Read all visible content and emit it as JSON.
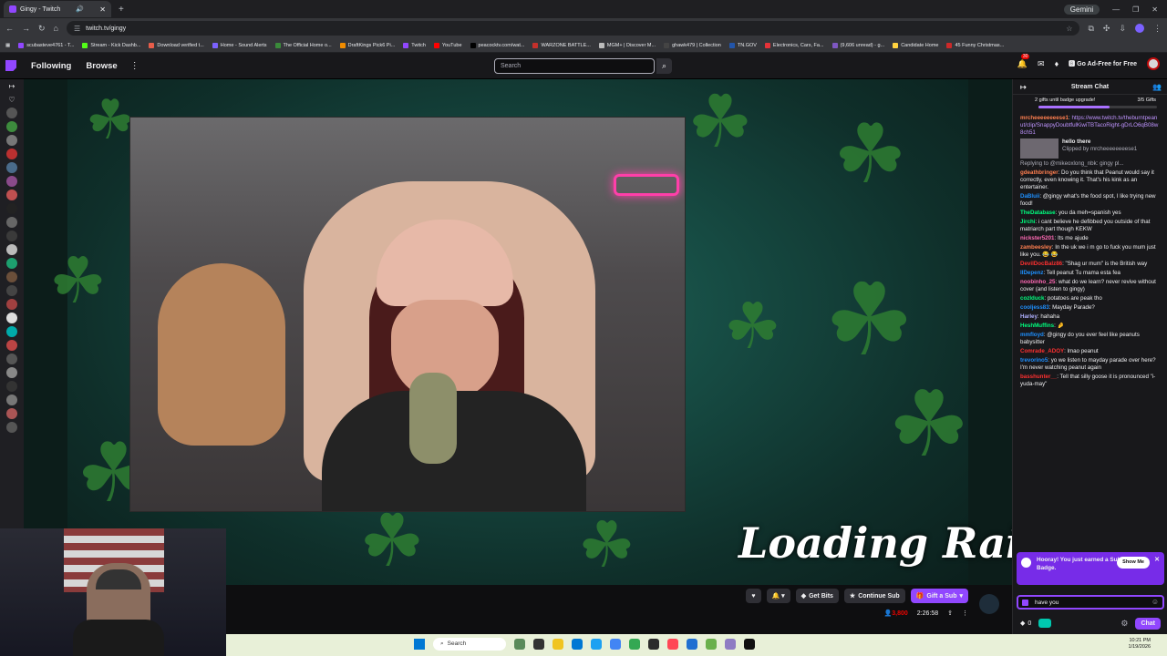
{
  "browser": {
    "tab_title": "Gingy - Twitch",
    "new_tab": "+",
    "profile_chip": "Gemini",
    "url": "twitch.tv/gingy",
    "bookmarks": [
      "scubasteve4761 - T...",
      "Stream - Kick Dashb...",
      "Download verified t...",
      "Home - Sound Alerts",
      "The Official Home o...",
      "DraftKings Pick6 Pi...",
      "Twitch",
      "YouTube",
      "peacocktv.com/wat...",
      "WARZONE BATTLE...",
      "MGM+ | Discover M...",
      "ghawk479 | Collection",
      "TN.GOV",
      "Electronics, Cars, Fa...",
      "(9,606 unread) - g...",
      "Candidate Home",
      "45 Funny Christmas..."
    ]
  },
  "twitch": {
    "nav_following": "Following",
    "nav_browse": "Browse",
    "search_placeholder": "Search",
    "notif_count": "30",
    "ad_free": "Go Ad-Free for Free"
  },
  "stream": {
    "overlay_text": "Loading Raid..",
    "buttons": {
      "get_bits": "Get Bits",
      "continue_sub": "Continue Sub",
      "gift_sub": "Gift a Sub"
    },
    "viewers": "3,800",
    "uptime": "2:26:58"
  },
  "chat": {
    "title": "Stream Chat",
    "gift_progress_label": "2 gifts until badge upgrade!",
    "gift_count": "3/5 Gifts",
    "gift_progress": 0.6,
    "messages": [
      {
        "user": "mrcheeeeeeeese1",
        "color": "#ff7f50",
        "text": "",
        "link": "https://www.twitch.tv/theburntpeanut/clip/SnappyDoubtfulKiwiTBTacoRight-gDrLO6qB08w8ch51"
      },
      {
        "user": "",
        "color": "",
        "text": "",
        "link": ""
      },
      {
        "user": "gdeathbringer",
        "color": "#ff7f50",
        "text": ": Do you think that Peanut would say it correctly, even knowing it. That's his kink as an entertainer."
      },
      {
        "user": "DaBluii",
        "color": "#1e90ff",
        "text": ": @gingy what's the food spot, I like trying new food!"
      },
      {
        "user": "TheDatabase",
        "color": "#00ff7f",
        "text": ": you da meh=spanish yes"
      },
      {
        "user": "Jirchi",
        "color": "#00ff7f",
        "text": ": i cant believe he defibbed you outside of that matriarch part though KEKW"
      },
      {
        "user": "nickster5201",
        "color": "#ff69b4",
        "text": ": Its me ajude"
      },
      {
        "user": "zambeesley",
        "color": "#ff7f50",
        "text": ": In the uk we i m go to fuck you mum just like you. 😂 😂"
      },
      {
        "user": "DevilDocBalz86",
        "color": "#ff3030",
        "text": ": \"Shag ur mum\" is the British way"
      },
      {
        "user": "IIDepenz",
        "color": "#1e90ff",
        "text": ": Tell peanut Tu mama esta fea"
      },
      {
        "user": "noobinho_25",
        "color": "#ff69b4",
        "text": ": what do we learn? never revive without cover (and listen to gingy)"
      },
      {
        "user": "cozlduck",
        "color": "#00ff7f",
        "text": ": potatoes are peak tho"
      },
      {
        "user": "cooljess83",
        "color": "#1e90ff",
        "text": ": Mayday Parade?"
      },
      {
        "user": "Harley",
        "color": "#b0b0ff",
        "text": ": hahaha"
      },
      {
        "user": "HeshMuffins",
        "color": "#00ff7f",
        "text": ": 🤌"
      },
      {
        "user": "mmfloyd",
        "color": "#1e90ff",
        "text": ": @gingy do you ever feel like peanuts babysitter"
      },
      {
        "user": "Comrade_ADOY",
        "color": "#ff3030",
        "text": ": lmao peanut"
      },
      {
        "user": "trevorino5",
        "color": "#1e90ff",
        "text": ": yo we listen to mayday parade over here? I'm never watching peanut again"
      },
      {
        "user": "basshunter__",
        "color": "#ff3030",
        "text": ": Tell that silly goose it is pronounced \"i-yuda-may\""
      }
    ],
    "clip": {
      "title": "hello there",
      "by": "Clipped by mrcheeeeeeeese1"
    },
    "reply_to": "Replying to @mikeoxlong_nbk: gingy pl...",
    "toast": {
      "text": "Hooray! You just earned a Subscription Badge.",
      "show_me": "Show Me",
      "close": "✕"
    },
    "input_value": "have you",
    "points": "0",
    "chat_button": "Chat"
  },
  "taskbar": {
    "search": "Search",
    "time": "10:21 PM",
    "date": "1/19/2026"
  }
}
